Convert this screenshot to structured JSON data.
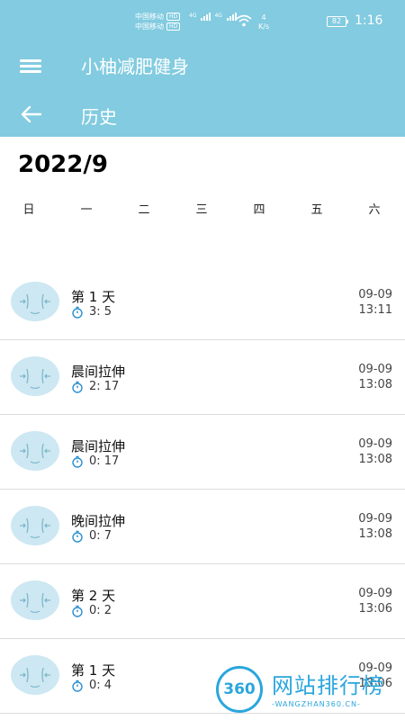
{
  "status_bar": {
    "carrier1": "中国移动",
    "carrier2": "中国移动",
    "hd": "HD",
    "network1": "4G",
    "network2": "4G",
    "speed_value": "4",
    "speed_unit": "K/s",
    "battery": "82",
    "time": "1:16"
  },
  "app_bar": {
    "title": "小柚减肥健身",
    "page_title": "历史"
  },
  "calendar": {
    "month": "2022/9",
    "weekdays": [
      "日",
      "一",
      "二",
      "三",
      "四",
      "五",
      "六"
    ]
  },
  "history": [
    {
      "name": "第 1 天",
      "duration": "3: 5",
      "date": "09-09",
      "time": "13:11"
    },
    {
      "name": "晨间拉伸",
      "duration": "2: 17",
      "date": "09-09",
      "time": "13:08"
    },
    {
      "name": "晨间拉伸",
      "duration": "0: 17",
      "date": "09-09",
      "time": "13:08"
    },
    {
      "name": "晚间拉伸",
      "duration": "0: 7",
      "date": "09-09",
      "time": "13:08"
    },
    {
      "name": "第 2 天",
      "duration": "0: 2",
      "date": "09-09",
      "time": "13:06"
    },
    {
      "name": "第 1 天",
      "duration": "0: 4",
      "date": "09-09",
      "time": "13:06"
    }
  ],
  "watermark": {
    "number": "360",
    "text": "网站排行榜",
    "url": "-WANGZHAN360.CN-"
  },
  "colors": {
    "header": "#82cbe0",
    "accent": "#2aa6dd"
  },
  "icons": [
    "menu-icon",
    "back-arrow-icon",
    "timer-icon",
    "wifi-icon",
    "battery-icon"
  ]
}
